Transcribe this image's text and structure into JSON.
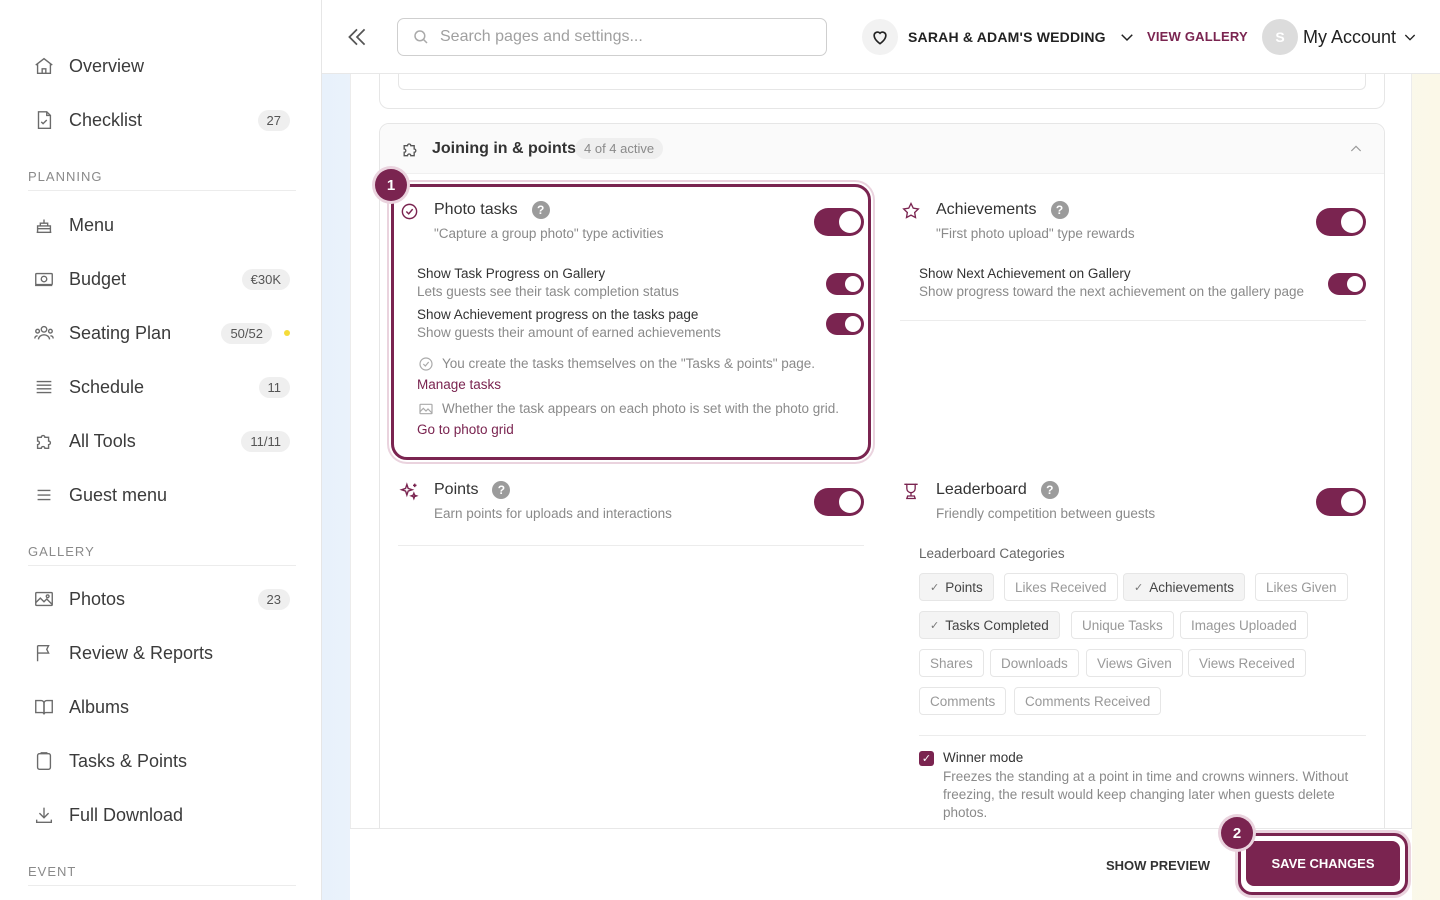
{
  "sidebar": {
    "items": [
      {
        "label": "Overview",
        "badge": null
      },
      {
        "label": "Checklist",
        "badge": "27"
      },
      {
        "label": "Menu",
        "badge": null
      },
      {
        "label": "Budget",
        "badge": "€30K"
      },
      {
        "label": "Seating Plan",
        "badge": "50/52"
      },
      {
        "label": "Schedule",
        "badge": "11"
      },
      {
        "label": "All Tools",
        "badge": "11/11"
      },
      {
        "label": "Guest menu",
        "badge": null
      },
      {
        "label": "Photos",
        "badge": "23"
      },
      {
        "label": "Review & Reports",
        "badge": null
      },
      {
        "label": "Albums",
        "badge": null
      },
      {
        "label": "Tasks & Points",
        "badge": null
      },
      {
        "label": "Full Download",
        "badge": null
      }
    ],
    "sections": {
      "planning": "PLANNING",
      "gallery": "GALLERY",
      "event": "EVENT"
    }
  },
  "header": {
    "search_placeholder": "Search pages and settings...",
    "event_name": "SARAH & ADAM'S WEDDING",
    "view_gallery": "VIEW GALLERY",
    "avatar_initial": "S",
    "account_label": "My Account"
  },
  "joining": {
    "title": "Joining in & points",
    "badge": "4 of 4 active",
    "photo_tasks": {
      "title": "Photo tasks",
      "desc": "\"Capture a group photo\" type activities",
      "enabled": true,
      "sub": [
        {
          "title": "Show Task Progress on Gallery",
          "desc": "Lets guests see their task completion status",
          "enabled": true
        },
        {
          "title": "Show Achievement progress on the tasks page",
          "desc": "Show guests their amount of earned achievements",
          "enabled": true
        }
      ],
      "info1": "You create the tasks themselves on the \"Tasks & points\" page.",
      "link1": "Manage tasks",
      "info2": "Whether the task appears on each photo is set with the photo grid.",
      "link2": "Go to photo grid"
    },
    "achievements": {
      "title": "Achievements",
      "desc": "\"First photo upload\" type rewards",
      "enabled": true,
      "sub_title": "Show Next Achievement on Gallery",
      "sub_desc": "Show progress toward the next achievement on the gallery page",
      "sub_enabled": true
    },
    "points": {
      "title": "Points",
      "desc": "Earn points for uploads and interactions",
      "enabled": true
    },
    "leaderboard": {
      "title": "Leaderboard",
      "desc": "Friendly competition between guests",
      "enabled": true,
      "categories_label": "Leaderboard Categories",
      "categories": [
        {
          "label": "Points",
          "selected": true
        },
        {
          "label": "Likes Received",
          "selected": false
        },
        {
          "label": "Achievements",
          "selected": true
        },
        {
          "label": "Likes Given",
          "selected": false
        },
        {
          "label": "Tasks Completed",
          "selected": true
        },
        {
          "label": "Unique Tasks",
          "selected": false
        },
        {
          "label": "Images Uploaded",
          "selected": false
        },
        {
          "label": "Shares",
          "selected": false
        },
        {
          "label": "Downloads",
          "selected": false
        },
        {
          "label": "Views Given",
          "selected": false
        },
        {
          "label": "Views Received",
          "selected": false
        },
        {
          "label": "Comments",
          "selected": false
        },
        {
          "label": "Comments Received",
          "selected": false
        }
      ],
      "winner_mode_label": "Winner mode",
      "winner_mode_checked": true,
      "winner_mode_desc": "Freezes the standing at a point in time and crowns winners. Without freezing, the result would keep changing later when guests delete photos."
    }
  },
  "footer": {
    "show_preview": "SHOW PREVIEW",
    "save_changes": "SAVE CHANGES"
  },
  "annotations": {
    "marker1": "1",
    "marker2": "2"
  },
  "colors": {
    "accent": "#7a2450",
    "highlight_ring": "#ead3de",
    "status_dot": "#f5dc3a"
  }
}
